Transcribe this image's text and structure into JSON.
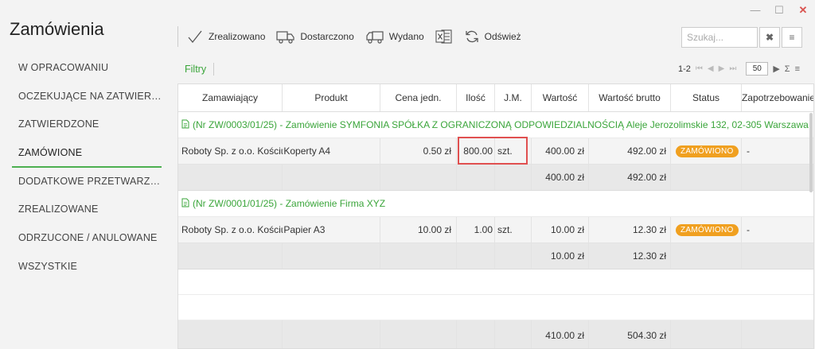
{
  "app": {
    "title": "Zamówienia"
  },
  "window": {
    "minimize": "—",
    "maximize": "☐",
    "close": "✕"
  },
  "sidebar": {
    "items": [
      {
        "label": "W OPRACOWANIU"
      },
      {
        "label": "OCZEKUJĄCE NA ZATWIER…"
      },
      {
        "label": "ZATWIERDZONE"
      },
      {
        "label": "ZAMÓWIONE",
        "active": true
      },
      {
        "label": "DODATKOWE PRZETWARZA…"
      },
      {
        "label": "ZREALIZOWANE"
      },
      {
        "label": "ODRZUCONE / ANULOWANE"
      },
      {
        "label": "WSZYSTKIE"
      }
    ]
  },
  "toolbar": {
    "realized": "Zrealizowano",
    "delivered": "Dostarczono",
    "issued": "Wydano",
    "refresh": "Odśwież"
  },
  "search": {
    "placeholder": "Szukaj..."
  },
  "filters": {
    "label": "Filtry"
  },
  "pager": {
    "range": "1-2",
    "page_size": "50"
  },
  "table": {
    "columns": [
      "Zamawiający",
      "Produkt",
      "Cena jedn.",
      "Ilość",
      "J.M.",
      "Wartość",
      "Wartość brutto",
      "Status",
      "Zapotrzebowanie"
    ],
    "groups": [
      {
        "title": "(Nr ZW/0003/01/25) - Zamówienie SYMFONIA SPÓŁKA Z OGRANICZONĄ ODPOWIEDZIALNOŚCIĄ Aleje Jerozolimskie 132, 02-305 Warszawa",
        "row": {
          "customer": "Roboty Sp. z o.o. Kościus",
          "product": "Koperty A4",
          "price": "0.50 zł",
          "qty": "800.00",
          "unit": "szt.",
          "value": "400.00 zł",
          "gross": "492.00 zł",
          "status": "ZAMÓWIONO",
          "demand": "-"
        },
        "sum": {
          "value": "400.00 zł",
          "gross": "492.00 zł"
        }
      },
      {
        "title": "(Nr ZW/0001/01/25) - Zamówienie Firma XYZ",
        "row": {
          "customer": "Roboty Sp. z o.o. Kościus",
          "product": "Papier A3",
          "price": "10.00 zł",
          "qty": "1.00",
          "unit": "szt.",
          "value": "10.00 zł",
          "gross": "12.30 zł",
          "status": "ZAMÓWIONO",
          "demand": "-"
        },
        "sum": {
          "value": "10.00 zł",
          "gross": "12.30 zł"
        }
      }
    ],
    "total": {
      "value": "410.00 zł",
      "gross": "504.30 zł"
    }
  }
}
